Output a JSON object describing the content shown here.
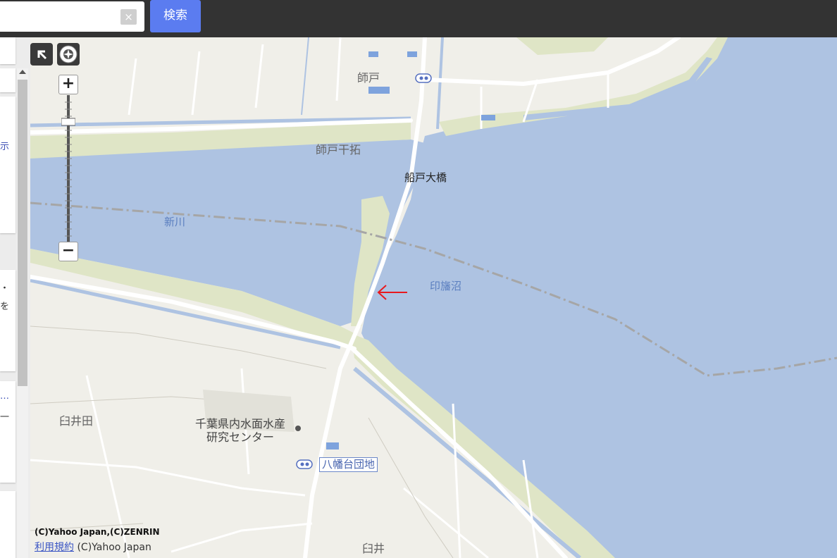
{
  "search": {
    "value": "",
    "clear_label": "×",
    "button_label": "検索"
  },
  "panel": {
    "top_fragment": "",
    "fragment_1": "示",
    "fragment_2": "・",
    "fragment_3": "を",
    "fragment_4": "…",
    "fragment_5": "一"
  },
  "map_controls": {
    "zoom_in_label": "+",
    "zoom_out_label": "−"
  },
  "map": {
    "places": {
      "moroto": "師戸",
      "moroto_kantaku": "師戸干拓",
      "usuida": "臼井田",
      "usui": "臼井"
    },
    "bridge": "船戸大橋",
    "rivers": {
      "shinkawa": "新川",
      "inbanuma": "印旛沼"
    },
    "facility": {
      "line1": "千葉県内水面水産",
      "line2": "研究センター"
    },
    "bus_stop": "八幡台団地",
    "colors": {
      "water": "#aec3e2",
      "land": "#f0efe9",
      "greenbank": "#dfe5c6",
      "arrow": "#e8191e"
    }
  },
  "attribution": {
    "copyright": "(C)Yahoo Japan,(C)ZENRIN",
    "terms_link": "利用規約",
    "terms_suffix": " (C)Yahoo Japan"
  }
}
